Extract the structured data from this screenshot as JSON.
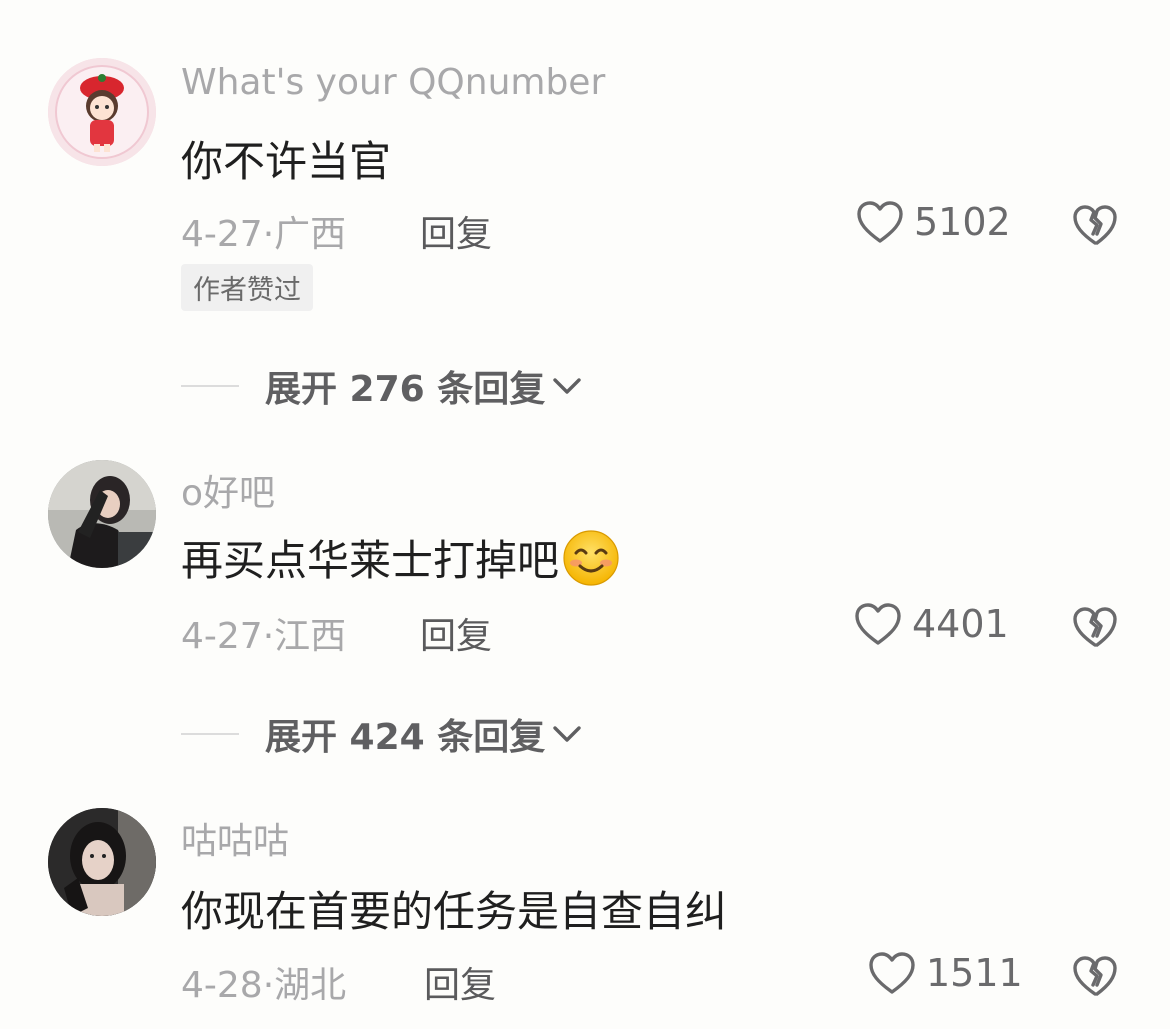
{
  "comments": [
    {
      "username": "What's your QQnumber",
      "text": "你不许当官",
      "date": "4-27",
      "separator": "·",
      "location": "广西",
      "reply_label": "回复",
      "likes": "5102",
      "badge": "作者赞过",
      "expand_label": "展开 276 条回复",
      "avatar_icon": "cartoon-girl-red-hat"
    },
    {
      "username": "o好吧",
      "text": "再买点华莱士打掉吧",
      "emoji": "smiling-face-icon",
      "date": "4-27",
      "separator": "·",
      "location": "江西",
      "reply_label": "回复",
      "likes": "4401",
      "expand_label": "展开 424 条回复",
      "avatar_icon": "photo-woman"
    },
    {
      "username": "咕咕咕",
      "text": "你现在首要的任务是自查自纠",
      "date": "4-28",
      "separator": "·",
      "location": "湖北",
      "reply_label": "回复",
      "likes": "1511",
      "avatar_icon": "photo-woman"
    }
  ],
  "colors": {
    "background": "#fdfdfb",
    "muted_text": "#a8a8aa",
    "body_text": "#1f1f1f"
  }
}
